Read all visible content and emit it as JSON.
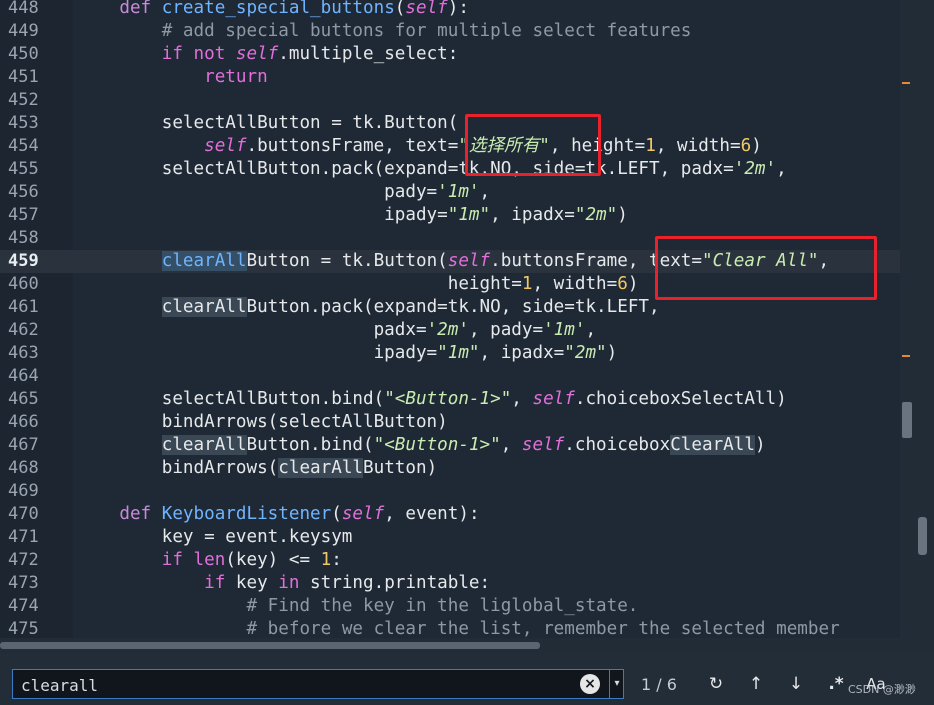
{
  "editor": {
    "current_line": 459,
    "lines": [
      {
        "n": 448,
        "tokens": [
          {
            "t": "    ",
            "c": "t-id"
          },
          {
            "t": "def ",
            "c": "t-def"
          },
          {
            "t": "create_special_buttons",
            "c": "t-fn"
          },
          {
            "t": "(",
            "c": "t-id"
          },
          {
            "t": "self",
            "c": "t-self"
          },
          {
            "t": "):",
            "c": "t-id"
          }
        ]
      },
      {
        "n": 449,
        "tokens": [
          {
            "t": "        ",
            "c": "t-id"
          },
          {
            "t": "# add special buttons for multiple select features",
            "c": "t-com"
          }
        ]
      },
      {
        "n": 450,
        "tokens": [
          {
            "t": "        ",
            "c": "t-id"
          },
          {
            "t": "if not ",
            "c": "t-kw"
          },
          {
            "t": "self",
            "c": "t-self"
          },
          {
            "t": ".multiple_select:",
            "c": "t-id"
          }
        ]
      },
      {
        "n": 451,
        "tokens": [
          {
            "t": "            ",
            "c": "t-id"
          },
          {
            "t": "return",
            "c": "t-kw"
          }
        ]
      },
      {
        "n": 452,
        "tokens": []
      },
      {
        "n": 453,
        "tokens": [
          {
            "t": "        selectAllButton = tk.Button(",
            "c": "t-id"
          }
        ]
      },
      {
        "n": 454,
        "tokens": [
          {
            "t": "            ",
            "c": "t-id"
          },
          {
            "t": "self",
            "c": "t-self"
          },
          {
            "t": ".buttonsFrame, text=",
            "c": "t-id"
          },
          {
            "t": "\"选择所有\"",
            "c": "t-str"
          },
          {
            "t": ", height=",
            "c": "t-id"
          },
          {
            "t": "1",
            "c": "t-num"
          },
          {
            "t": ", width=",
            "c": "t-id"
          },
          {
            "t": "6",
            "c": "t-num"
          },
          {
            "t": ")",
            "c": "t-id"
          }
        ]
      },
      {
        "n": 455,
        "tokens": [
          {
            "t": "        selectAllButton.pack(expand=tk.NO, side=tk.LEFT, padx=",
            "c": "t-id"
          },
          {
            "t": "'2m'",
            "c": "t-str"
          },
          {
            "t": ",",
            "c": "t-id"
          }
        ]
      },
      {
        "n": 456,
        "tokens": [
          {
            "t": "                             pady=",
            "c": "t-id"
          },
          {
            "t": "'1m'",
            "c": "t-str"
          },
          {
            "t": ",",
            "c": "t-id"
          }
        ]
      },
      {
        "n": 457,
        "tokens": [
          {
            "t": "                             ipady=",
            "c": "t-id"
          },
          {
            "t": "\"1m\"",
            "c": "t-str"
          },
          {
            "t": ", ipadx=",
            "c": "t-id"
          },
          {
            "t": "\"2m\"",
            "c": "t-str"
          },
          {
            "t": ")",
            "c": "t-id"
          }
        ]
      },
      {
        "n": 458,
        "tokens": []
      },
      {
        "n": 459,
        "tokens": [
          {
            "t": "        ",
            "c": "t-id"
          },
          {
            "t": "clearAll",
            "c": "t-fn t-hl"
          },
          {
            "t": "Button = tk.Button(",
            "c": "t-id"
          },
          {
            "t": "self",
            "c": "t-self"
          },
          {
            "t": ".buttonsFrame, text=",
            "c": "t-id"
          },
          {
            "t": "\"Clear All\"",
            "c": "t-str"
          },
          {
            "t": ",",
            "c": "t-id"
          }
        ]
      },
      {
        "n": 460,
        "tokens": [
          {
            "t": "                                   height=",
            "c": "t-id"
          },
          {
            "t": "1",
            "c": "t-num"
          },
          {
            "t": ", width=",
            "c": "t-id"
          },
          {
            "t": "6",
            "c": "t-num"
          },
          {
            "t": ")",
            "c": "t-id"
          }
        ]
      },
      {
        "n": 461,
        "tokens": [
          {
            "t": "        ",
            "c": "t-id"
          },
          {
            "t": "clearAll",
            "c": "t-id t-hl2"
          },
          {
            "t": "Button.pack(expand=tk.NO, side=tk.LEFT,",
            "c": "t-id"
          }
        ]
      },
      {
        "n": 462,
        "tokens": [
          {
            "t": "                            padx=",
            "c": "t-id"
          },
          {
            "t": "'2m'",
            "c": "t-str"
          },
          {
            "t": ", pady=",
            "c": "t-id"
          },
          {
            "t": "'1m'",
            "c": "t-str"
          },
          {
            "t": ",",
            "c": "t-id"
          }
        ]
      },
      {
        "n": 463,
        "tokens": [
          {
            "t": "                            ipady=",
            "c": "t-id"
          },
          {
            "t": "\"1m\"",
            "c": "t-str"
          },
          {
            "t": ", ipadx=",
            "c": "t-id"
          },
          {
            "t": "\"2m\"",
            "c": "t-str"
          },
          {
            "t": ")",
            "c": "t-id"
          }
        ]
      },
      {
        "n": 464,
        "tokens": []
      },
      {
        "n": 465,
        "tokens": [
          {
            "t": "        selectAllButton.bind(",
            "c": "t-id"
          },
          {
            "t": "\"<Button-1>\"",
            "c": "t-str"
          },
          {
            "t": ", ",
            "c": "t-id"
          },
          {
            "t": "self",
            "c": "t-self"
          },
          {
            "t": ".choiceboxSelectAll)",
            "c": "t-id"
          }
        ]
      },
      {
        "n": 466,
        "tokens": [
          {
            "t": "        bindArrows(selectAllButton)",
            "c": "t-id"
          }
        ]
      },
      {
        "n": 467,
        "tokens": [
          {
            "t": "        ",
            "c": "t-id"
          },
          {
            "t": "clearAll",
            "c": "t-id t-hl2"
          },
          {
            "t": "Button.bind(",
            "c": "t-id"
          },
          {
            "t": "\"<Button-1>\"",
            "c": "t-str"
          },
          {
            "t": ", ",
            "c": "t-id"
          },
          {
            "t": "self",
            "c": "t-self"
          },
          {
            "t": ".choicebox",
            "c": "t-id"
          },
          {
            "t": "ClearAll",
            "c": "t-id t-hl2"
          },
          {
            "t": ")",
            "c": "t-id"
          }
        ]
      },
      {
        "n": 468,
        "tokens": [
          {
            "t": "        bindArrows(",
            "c": "t-id"
          },
          {
            "t": "clearAll",
            "c": "t-id t-hl2"
          },
          {
            "t": "Button)",
            "c": "t-id"
          }
        ]
      },
      {
        "n": 469,
        "tokens": []
      },
      {
        "n": 470,
        "tokens": [
          {
            "t": "    ",
            "c": "t-id"
          },
          {
            "t": "def ",
            "c": "t-def"
          },
          {
            "t": "KeyboardListener",
            "c": "t-fn"
          },
          {
            "t": "(",
            "c": "t-id"
          },
          {
            "t": "self",
            "c": "t-self"
          },
          {
            "t": ", event):",
            "c": "t-id"
          }
        ]
      },
      {
        "n": 471,
        "tokens": [
          {
            "t": "        key = event.keysym",
            "c": "t-id"
          }
        ]
      },
      {
        "n": 472,
        "tokens": [
          {
            "t": "        ",
            "c": "t-id"
          },
          {
            "t": "if ",
            "c": "t-kw"
          },
          {
            "t": "len",
            "c": "t-kw"
          },
          {
            "t": "(key) <= ",
            "c": "t-id"
          },
          {
            "t": "1",
            "c": "t-num"
          },
          {
            "t": ":",
            "c": "t-id"
          }
        ]
      },
      {
        "n": 473,
        "tokens": [
          {
            "t": "            ",
            "c": "t-id"
          },
          {
            "t": "if ",
            "c": "t-kw"
          },
          {
            "t": "key ",
            "c": "t-id"
          },
          {
            "t": "in ",
            "c": "t-kw"
          },
          {
            "t": "string.printable:",
            "c": "t-id"
          }
        ]
      },
      {
        "n": 474,
        "tokens": [
          {
            "t": "                ",
            "c": "t-id"
          },
          {
            "t": "# Find the key in the liglobal_state.",
            "c": "t-com"
          }
        ]
      },
      {
        "n": 475,
        "tokens": [
          {
            "t": "                ",
            "c": "t-id"
          },
          {
            "t": "# before we clear the list, remember the selected member",
            "c": "t-com"
          }
        ]
      }
    ]
  },
  "find": {
    "query": "clearall",
    "match_count": "1 / 6",
    "clear_icon": "×",
    "dropdown_icon": "▾",
    "buttons": [
      {
        "name": "replace-icon",
        "glyph": "↻"
      },
      {
        "name": "find-previous-icon",
        "glyph": "↑"
      },
      {
        "name": "find-next-icon",
        "glyph": "↓"
      },
      {
        "name": "regex-icon",
        "glyph": ".*"
      },
      {
        "name": "match-case-icon",
        "glyph": "Aa"
      }
    ]
  },
  "watermark": "CSDN @渺渺"
}
